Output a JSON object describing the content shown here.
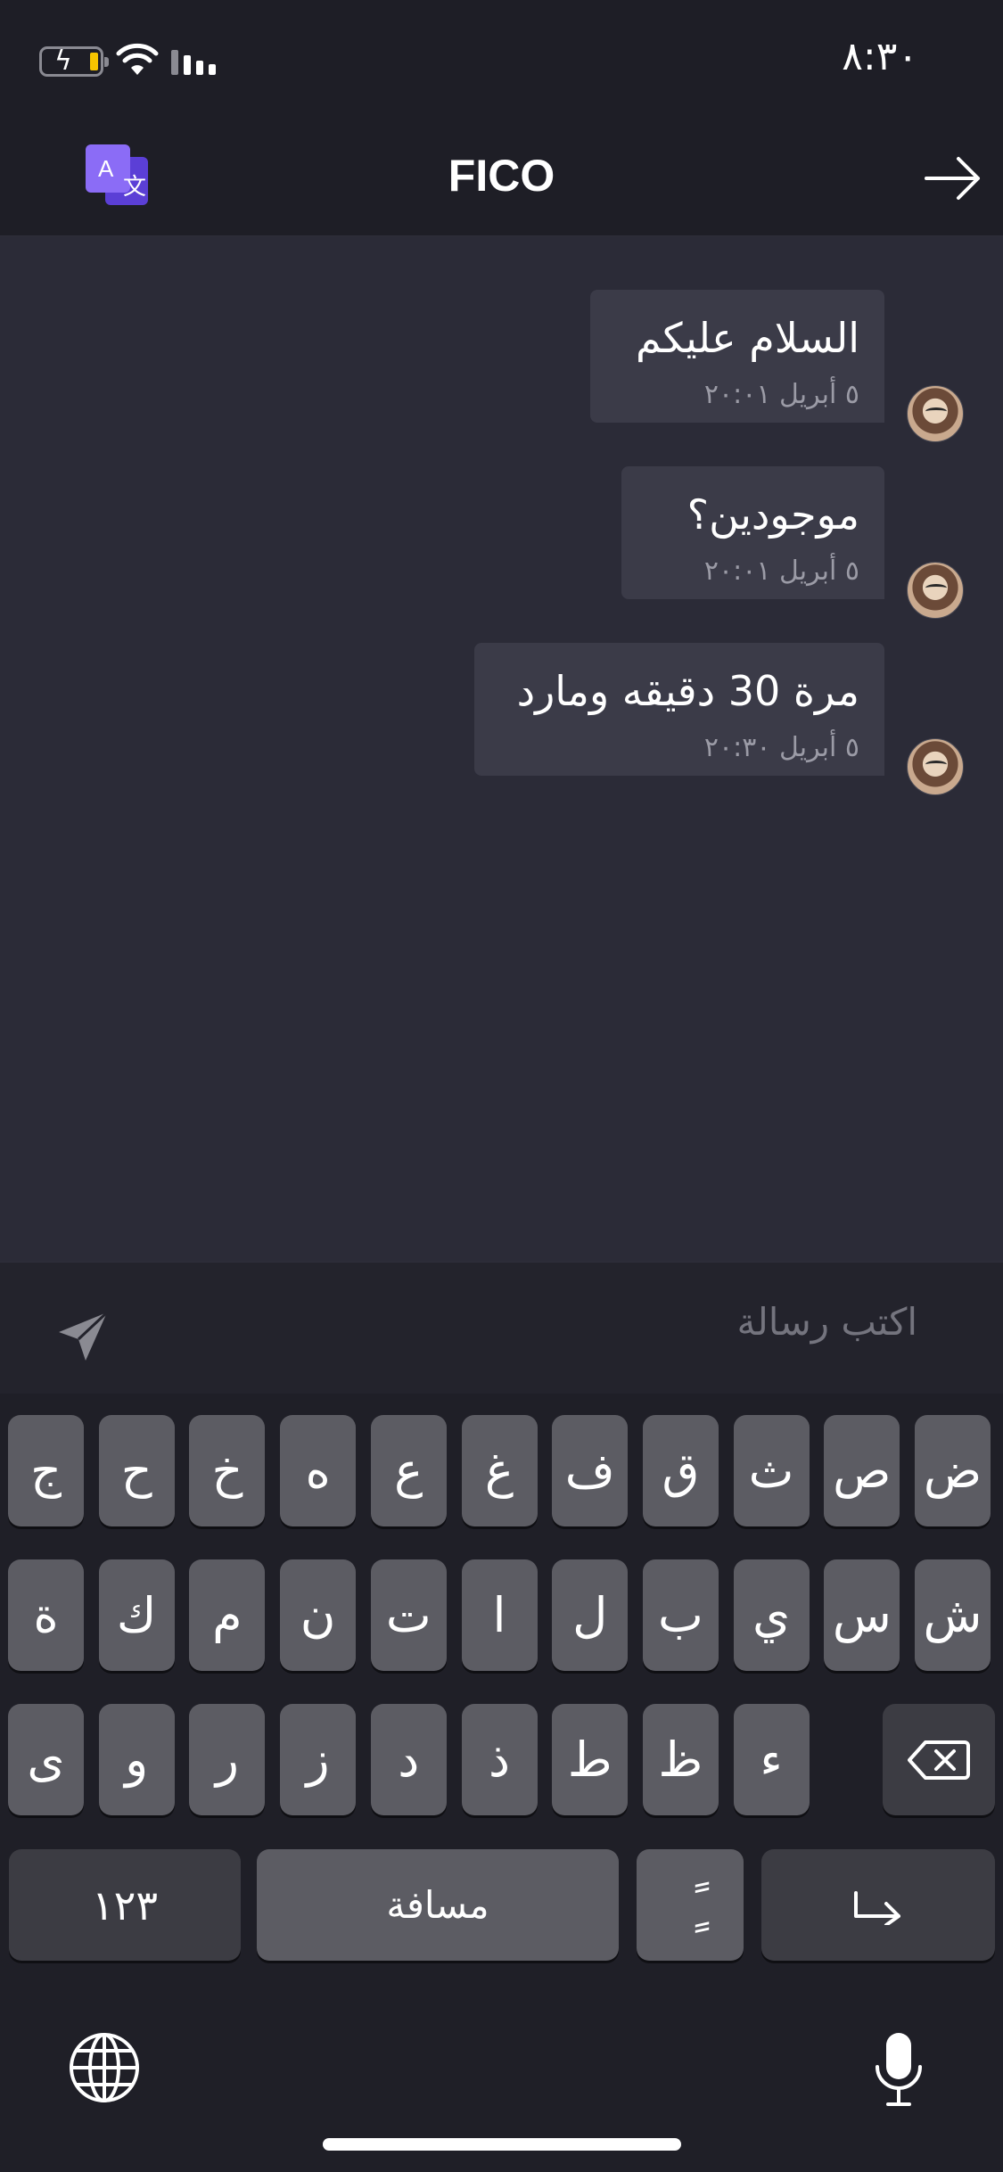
{
  "status_bar": {
    "time": "٨:٣٠"
  },
  "header": {
    "title": "FICO"
  },
  "messages": [
    {
      "text": "السلام عليكم",
      "time": "٥ أبريل ٢٠:٠١"
    },
    {
      "text": "موجودين؟",
      "time": "٥ أبريل ٢٠:٠١"
    },
    {
      "text": "مرة 30 دقيقه ومارد",
      "time": "٥ أبريل ٢٠:٣٠"
    }
  ],
  "input": {
    "placeholder": "اكتب رسالة"
  },
  "keyboard": {
    "row1": [
      "ض",
      "ص",
      "ث",
      "ق",
      "ف",
      "غ",
      "ع",
      "ه",
      "خ",
      "ح",
      "ج"
    ],
    "row2": [
      "ش",
      "س",
      "ي",
      "ب",
      "ل",
      "ا",
      "ت",
      "ن",
      "م",
      "ك",
      "ة"
    ],
    "row3": [
      "ء",
      "ظ",
      "ط",
      "ذ",
      "د",
      "ز",
      "ر",
      "و",
      "ى"
    ],
    "numbers_label": "١٢٣",
    "space_label": "مسافة",
    "diacritic_label": "ًٍ",
    "return_symbol": "↵"
  },
  "icons": {
    "translate": "translate-icon",
    "forward": "arrow-right-icon",
    "send": "send-icon",
    "backspace": "backspace-icon",
    "globe": "globe-icon",
    "mic": "microphone-icon"
  },
  "colors": {
    "background": "#1e1e26",
    "chat_background": "#2b2b37",
    "bubble": "#3b3b48",
    "translate_accent": "#7b5cf0",
    "battery": "#f5c400"
  }
}
